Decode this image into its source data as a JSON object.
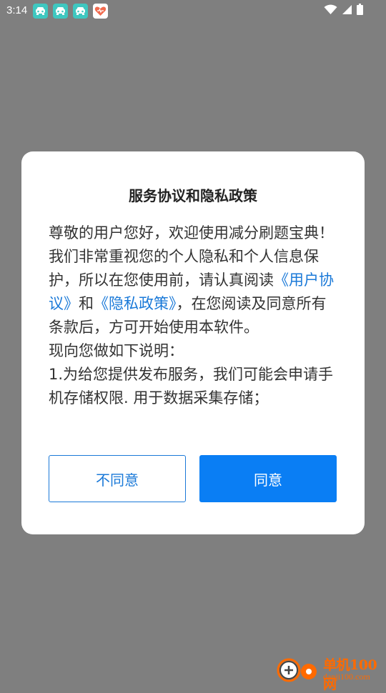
{
  "status_bar": {
    "time": "3:14",
    "notification_icons": [
      "app-icon",
      "app-icon",
      "app-icon",
      "heart-app-icon"
    ],
    "system_icons": [
      "wifi-icon",
      "signal-icon",
      "battery-icon"
    ]
  },
  "dialog": {
    "title": "服务协议和隐私政策",
    "body": {
      "intro_before_links": "尊敬的用户您好，欢迎使用减分刷题宝典！我们非常重视您的个人隐私和个人信息保护，所以在您使用前，请认真阅读",
      "user_agreement_link": "《用户协议》",
      "conjunction": "和",
      "privacy_policy_link": "《隐私政策》",
      "intro_after_links": "，在您阅读及同意所有条款后，方可开始使用本软件。",
      "explanation_heading": "现向您做如下说明：",
      "item_1": "1.为给您提供发布服务，我们可能会申请手机存储权限. 用于数据采集存储；"
    },
    "disagree_label": "不同意",
    "agree_label": "同意"
  },
  "watermark": {
    "site_name": "单机100网",
    "site_url": "danji100.com"
  },
  "colors": {
    "overlay": "#7f7f7f",
    "link": "#1a79d8",
    "primary_button": "#0a7ef4",
    "watermark": "#ff6a00"
  }
}
